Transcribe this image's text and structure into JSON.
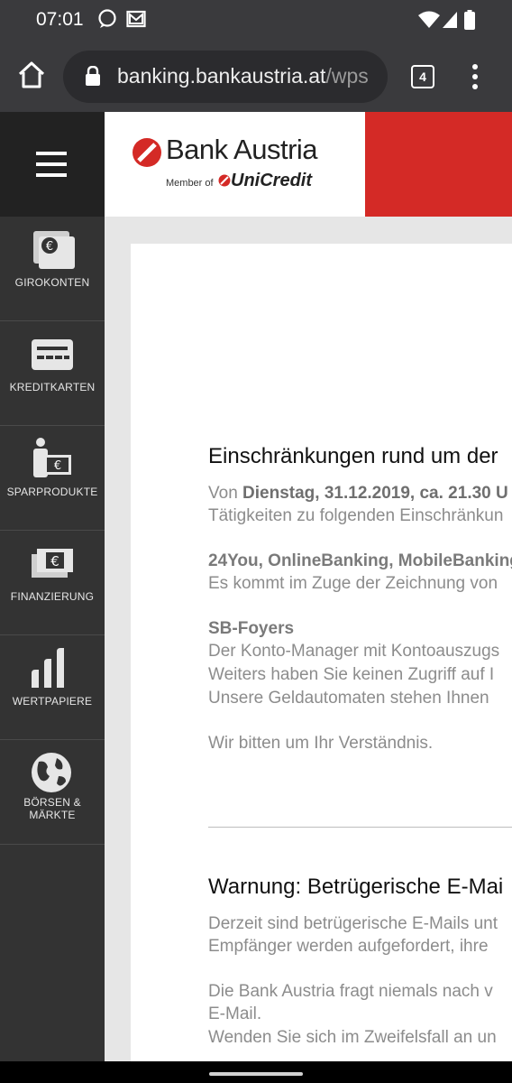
{
  "status": {
    "time": "07:01"
  },
  "browser": {
    "url_host": "banking.bankaustria.at",
    "url_rest": "/wps",
    "tab_count": "4"
  },
  "brand": {
    "name": "Bank Austria",
    "member_of": "Member of",
    "parent": "UniCredit",
    "accent_color": "#d42a26"
  },
  "sidebar": {
    "items": [
      {
        "label": "GIROKONTEN",
        "icon": "wallet-euro-icon"
      },
      {
        "label": "KREDITKARTEN",
        "icon": "credit-card-icon"
      },
      {
        "label": "SPARPRODUKTE",
        "icon": "piggy-euro-icon"
      },
      {
        "label": "FINANZIERUNG",
        "icon": "banknotes-icon"
      },
      {
        "label": "WERTPAPIERE",
        "icon": "bar-chart-icon"
      },
      {
        "label": "BÖRSEN &",
        "label2": "MÄRKTE",
        "icon": "globe-icon"
      }
    ]
  },
  "notice1": {
    "title": "Einschränkungen rund um der",
    "line1_a": "Von ",
    "line1_b": "Dienstag, 31.12.2019, ca. 21.30 U",
    "line2": "Tätigkeiten zu folgenden Einschränkun",
    "sub1": "24You, OnlineBanking, MobileBanking",
    "sub1_text": "Es kommt im Zuge der Zeichnung von",
    "sub2": "SB-Foyers",
    "sub2_l1": "Der Konto-Manager mit Kontoauszugs",
    "sub2_l2": "Weiters haben Sie keinen Zugriff auf I",
    "sub2_l3": "Unsere Geldautomaten stehen Ihnen",
    "closing": "Wir bitten um Ihr Verständnis."
  },
  "notice2": {
    "title": "Warnung: Betrügerische E-Mai",
    "l1": "Derzeit sind betrügerische E-Mails unt",
    "l2": "Empfänger werden aufgefordert, ihre",
    "l3": "Die Bank Austria fragt niemals nach v",
    "l4": "E-Mail.",
    "l5": "Wenden Sie sich im Zweifelsfall an un"
  }
}
